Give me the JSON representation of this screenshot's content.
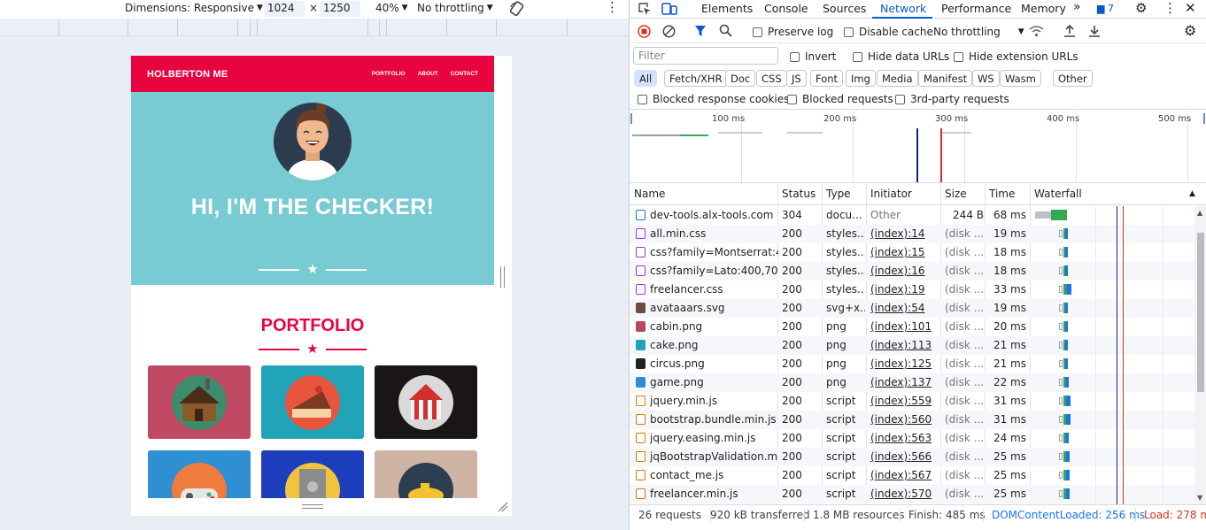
{
  "device_toolbar": {
    "dimensions_label": "Dimensions: Responsive",
    "width": "1024",
    "times": "×",
    "height": "1250",
    "zoom": "40%",
    "throttling": "No throttling"
  },
  "page": {
    "brand": "HOLBERTON ME",
    "nav_links": [
      "PORTFOLIO",
      "ABOUT",
      "CONTACT"
    ],
    "headline": "HI, I'M THE CHECKER!",
    "section_title": "PORTFOLIO",
    "colors": {
      "accent": "#e8043f",
      "masthead": "#78cbd2"
    },
    "tiles": [
      {
        "name": "cabin",
        "bg": "#c04a64"
      },
      {
        "name": "cake",
        "bg": "#21a4b8"
      },
      {
        "name": "circus",
        "bg": "#1b1616"
      },
      {
        "name": "game",
        "bg": "#2e8fd3"
      },
      {
        "name": "safe",
        "bg": "#1e3fbd"
      },
      {
        "name": "submarine",
        "bg": "#cfb3a4"
      }
    ]
  },
  "devtools": {
    "tabs": [
      "Elements",
      "Console",
      "Sources",
      "Network",
      "Performance",
      "Memory"
    ],
    "active_tab": "Network",
    "overflow": "»",
    "issues_count": "7",
    "toolbar": {
      "preserve_log": "Preserve log",
      "disable_cache": "Disable cache",
      "throttling": "No throttling"
    },
    "filter": {
      "placeholder": "Filter",
      "invert": "Invert",
      "hide_data_urls": "Hide data URLs",
      "hide_extension_urls": "Hide extension URLs",
      "types": [
        "All",
        "Fetch/XHR",
        "Doc",
        "CSS",
        "JS",
        "Font",
        "Img",
        "Media",
        "Manifest",
        "WS",
        "Wasm",
        "Other"
      ],
      "active_type": "All",
      "blocked_cookies": "Blocked response cookies",
      "blocked_requests": "Blocked requests",
      "third_party": "3rd-party requests"
    },
    "overview_ticks": [
      "100 ms",
      "200 ms",
      "300 ms",
      "400 ms",
      "500 ms"
    ],
    "columns": [
      "Name",
      "Status",
      "Type",
      "Initiator",
      "Size",
      "Time",
      "Waterfall"
    ],
    "rows": [
      {
        "name": "dev-tools.alx-tools.com",
        "status": "304",
        "type": "docu...",
        "initiator": "Other",
        "size": "244 B",
        "time": "68 ms",
        "icon": "document-icon",
        "icolor": "#1a73e8"
      },
      {
        "name": "all.min.css",
        "status": "200",
        "type": "styles...",
        "initiator": "(index):14",
        "size": "(disk ...",
        "time": "19 ms",
        "icon": "stylesheet-icon",
        "icolor": "#9334e6"
      },
      {
        "name": "css?family=Montserrat:4...",
        "status": "200",
        "type": "styles...",
        "initiator": "(index):15",
        "size": "(disk ...",
        "time": "18 ms",
        "icon": "stylesheet-icon",
        "icolor": "#9334e6"
      },
      {
        "name": "css?family=Lato:400,700...",
        "status": "200",
        "type": "styles...",
        "initiator": "(index):16",
        "size": "(disk ...",
        "time": "18 ms",
        "icon": "stylesheet-icon",
        "icolor": "#9334e6"
      },
      {
        "name": "freelancer.css",
        "status": "200",
        "type": "styles...",
        "initiator": "(index):19",
        "size": "(disk ...",
        "time": "33 ms",
        "icon": "stylesheet-icon",
        "icolor": "#9334e6"
      },
      {
        "name": "avataaars.svg",
        "status": "200",
        "type": "svg+x...",
        "initiator": "(index):54",
        "size": "(disk ...",
        "time": "19 ms",
        "icon": "image-icon",
        "icolor": "#6d4c41"
      },
      {
        "name": "cabin.png",
        "status": "200",
        "type": "png",
        "initiator": "(index):101",
        "size": "(disk ...",
        "time": "20 ms",
        "icon": "image-icon",
        "icolor": "#b5475e"
      },
      {
        "name": "cake.png",
        "status": "200",
        "type": "png",
        "initiator": "(index):113",
        "size": "(disk ...",
        "time": "21 ms",
        "icon": "image-icon",
        "icolor": "#21a4b8"
      },
      {
        "name": "circus.png",
        "status": "200",
        "type": "png",
        "initiator": "(index):125",
        "size": "(disk ...",
        "time": "21 ms",
        "icon": "image-icon",
        "icolor": "#222"
      },
      {
        "name": "game.png",
        "status": "200",
        "type": "png",
        "initiator": "(index):137",
        "size": "(disk ...",
        "time": "22 ms",
        "icon": "image-icon",
        "icolor": "#2e8fd3"
      },
      {
        "name": "jquery.min.js",
        "status": "200",
        "type": "script",
        "initiator": "(index):559",
        "size": "(disk ...",
        "time": "31 ms",
        "icon": "script-icon",
        "icolor": "#e37400"
      },
      {
        "name": "bootstrap.bundle.min.js",
        "status": "200",
        "type": "script",
        "initiator": "(index):560",
        "size": "(disk ...",
        "time": "31 ms",
        "icon": "script-icon",
        "icolor": "#e37400"
      },
      {
        "name": "jquery.easing.min.js",
        "status": "200",
        "type": "script",
        "initiator": "(index):563",
        "size": "(disk ...",
        "time": "24 ms",
        "icon": "script-icon",
        "icolor": "#e37400"
      },
      {
        "name": "jqBootstrapValidation.mi...",
        "status": "200",
        "type": "script",
        "initiator": "(index):566",
        "size": "(disk ...",
        "time": "25 ms",
        "icon": "script-icon",
        "icolor": "#e37400"
      },
      {
        "name": "contact_me.js",
        "status": "200",
        "type": "script",
        "initiator": "(index):567",
        "size": "(disk ...",
        "time": "25 ms",
        "icon": "script-icon",
        "icolor": "#e37400"
      },
      {
        "name": "freelancer.min.js",
        "status": "200",
        "type": "script",
        "initiator": "(index):570",
        "size": "(disk ...",
        "time": "25 ms",
        "icon": "script-icon",
        "icolor": "#e37400"
      }
    ],
    "status_bar": {
      "requests": "26 requests",
      "transferred": "920 kB transferred",
      "resources": "1.8 MB resources",
      "finish": "Finish: 485 ms",
      "dom_loaded": "DOMContentLoaded: 256 ms",
      "load": "Load: 278 m"
    }
  }
}
